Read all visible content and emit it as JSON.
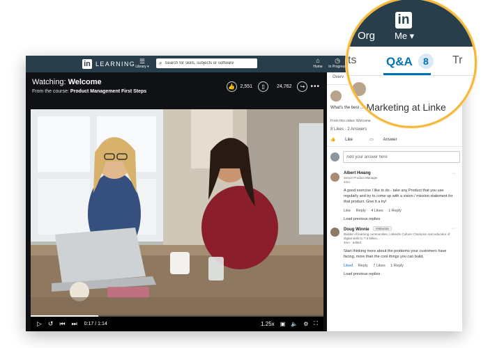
{
  "app": {
    "logo_text": "LEARNING",
    "library_label": "Library ▾",
    "search_placeholder": "Search for skills, subjects or software",
    "nav": [
      {
        "label": "Home",
        "icon": "home-icon"
      },
      {
        "label": "In Progress",
        "icon": "clock-icon"
      }
    ]
  },
  "video": {
    "watching_prefix": "Watching:",
    "watching_title": "Welcome",
    "course_prefix": "From the course:",
    "course_title": "Product Management First Steps",
    "likes": "2,551",
    "saves": "24,762",
    "time": "0:17 / 1:14",
    "speed": "1.25x",
    "progress": 0.23
  },
  "sidebar": {
    "tab_label": "Overv",
    "question_text": "What's the best ... Marketing at Linkedin life?",
    "from_video": "From this video: Welcome",
    "counts": "8 Likes · 2 Answers",
    "like_label": "Like",
    "answer_label": "Answer",
    "answer_placeholder": "Add your answer here",
    "replies": [
      {
        "name": "Albert Hwang",
        "title": "Senior Product Manager",
        "time": "4mo",
        "text": "A good exercise I like to do - take any Product that you use regularly and try to come up with a vision / mission statement for that product. Give it a try!",
        "like": "Like",
        "reply": "Reply",
        "likes": "4 Likes",
        "replies": "1 Reply",
        "load": "Load previous replies"
      },
      {
        "name": "Doug Winnie",
        "badge": "Instructor",
        "title": "Builder of learning communities, LinkedIn Culture Champion and educator of digital skills to 7.6 billion...",
        "time": "4mo · edited",
        "text": "Start thinking more about the problems your customers have facing, more than the cool things you can build.",
        "like": "Liked",
        "reply": "Reply",
        "likes": "7 Likes",
        "replies": "1 Reply",
        "load": "Load previous replies"
      }
    ]
  },
  "magnifier": {
    "org_label": "Org",
    "me_label": "Me ▾",
    "tab_left": "ts",
    "tab_active": "Q&A",
    "tab_count": "8",
    "tab_right": "Tr",
    "question_fragment": "...ct Marketing at Linke"
  },
  "colors": {
    "nav_bg": "#283e4a",
    "accent": "#0073b1",
    "magnifier_ring": "#f5b83d"
  }
}
